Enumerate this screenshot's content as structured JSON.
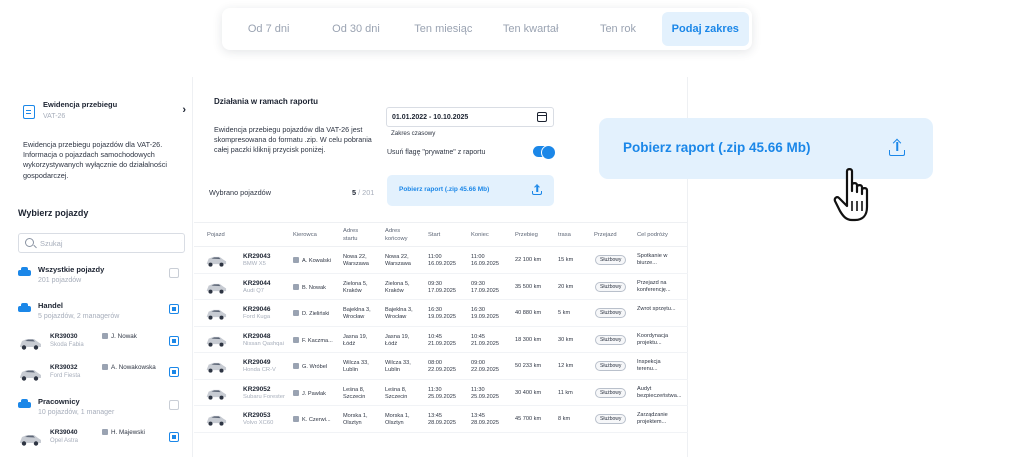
{
  "range_tabs": [
    {
      "label": "Od 7 dni",
      "active": false
    },
    {
      "label": "Od 30 dni",
      "active": false
    },
    {
      "label": "Ten miesiąc",
      "active": false
    },
    {
      "label": "Ten kwartał",
      "active": false
    },
    {
      "label": "Ten rok",
      "active": false
    },
    {
      "label": "Podaj zakres",
      "active": true
    }
  ],
  "left": {
    "report_title": "Ewidencja przebiegu",
    "report_sub": "VAT-26",
    "report_desc": "Ewidencja przebiegu pojazdów dla VAT-26. Informacja o pojazdach samochodowych wykorzystywanych wyłącznie do działalności gospodarczej.",
    "select_title": "Wybierz pojazdy",
    "search_placeholder": "Szukaj",
    "groups": [
      {
        "title": "Wszystkie pojazdy",
        "sub": "201 pojazdów",
        "checked": false
      },
      {
        "title": "Handel",
        "sub": "5 pojazdów, 2 managerów",
        "checked": true
      },
      {
        "title": "Pracownicy",
        "sub": "10 pojazdów, 1 manager",
        "checked": false
      }
    ],
    "vehicles": [
      {
        "plate": "KR39030",
        "model": "Skoda Fabia",
        "user": "J. Nowak",
        "checked": true
      },
      {
        "plate": "KR39032",
        "model": "Ford Fiesta",
        "user": "A. Nowakowska",
        "checked": true
      },
      {
        "plate": "KR39040",
        "model": "Opel Astra",
        "user": "H. Majewski",
        "checked": true
      }
    ]
  },
  "mid": {
    "title": "Działania w ramach raportu",
    "desc": "Ewidencja przebiegu pojazdów dla VAT-26 jest skompresowana do formatu .zip. W celu pobrania całej paczki kliknij przycisk poniżej.",
    "selected_label": "Wybrano pojazdów",
    "selected_count": "5",
    "selected_total": " / 201",
    "date_value": "01.01.2022 - 10.10.2025",
    "date_caption": "Zakres czasowy",
    "flag_label": "Usuń flagę \"prywatne\" z raportu",
    "download_small": "Pobierz raport (.zip 45.66 Mb)"
  },
  "table": {
    "headers": {
      "vehicle": "Pojazd",
      "driver": "Kierowca",
      "from_addr": "Adres startu",
      "to_addr": "Adres końcowy",
      "start": "Start",
      "end": "Koniec",
      "mileage": "Przebieg",
      "route": "trasa",
      "trip": "Przejazd",
      "purpose": "Cel podróży"
    },
    "rows": [
      {
        "plate": "KR29043",
        "model": "BMW X5",
        "driver": "A. Kowalski",
        "from": "Nowa 22, Warszawa",
        "to": "Nowa 22, Warszawa",
        "start": "11:00 16.09.2025",
        "end": "11:00 16.09.2025",
        "mileage": "22 100 km",
        "route": "15 km",
        "trip": "Służbowy",
        "purpose": "Spotkanie w biurze..."
      },
      {
        "plate": "KR29044",
        "model": "Audi Q7",
        "driver": "B. Nowak",
        "from": "Zielona 5, Kraków",
        "to": "Zielona 5, Kraków",
        "start": "09:30 17.09.2025",
        "end": "09:30 17.09.2025",
        "mileage": "35 500 km",
        "route": "20 km",
        "trip": "Służbowy",
        "purpose": "Przejazd na konferencję..."
      },
      {
        "plate": "KR29046",
        "model": "Ford Kuga",
        "driver": "D. Zieliński",
        "from": "Bajeklna 3, Wrocław",
        "to": "Bajeklna 3, Wrocław",
        "start": "16:30 19.09.2025",
        "end": "16:30 19.09.2025",
        "mileage": "40 880 km",
        "route": "5 km",
        "trip": "Służbowy",
        "purpose": "Zwrot sprzętu..."
      },
      {
        "plate": "KR29048",
        "model": "Nissan Qashqai",
        "driver": "F. Kaczma...",
        "from": "Jasna 19, Łódź",
        "to": "Jasna 19, Łódź",
        "start": "10:45 21.09.2025",
        "end": "10:45 21.09.2025",
        "mileage": "18 300 km",
        "route": "30 km",
        "trip": "Służbowy",
        "purpose": "Koordynacja projektu..."
      },
      {
        "plate": "KR29049",
        "model": "Honda CR-V",
        "driver": "G. Wróbel",
        "from": "Wilcza 33, Lublin",
        "to": "Wilcza 33, Lublin",
        "start": "08:00 22.09.2025",
        "end": "09:00 22.09.2025",
        "mileage": "50 233 km",
        "route": "12 km",
        "trip": "Służbowy",
        "purpose": "Inspekcja terenu..."
      },
      {
        "plate": "KR29052",
        "model": "Subaru Forester",
        "driver": "J. Pawlak",
        "from": "Leśna 8, Szczecin",
        "to": "Leśna 8, Szczecin",
        "start": "11:30 25.09.2025",
        "end": "11:30 25.09.2025",
        "mileage": "30 400 km",
        "route": "11 km",
        "trip": "Służbowy",
        "purpose": "Audyt bezpieczeństwa..."
      },
      {
        "plate": "KR29053",
        "model": "Volvo XC60",
        "driver": "K. Czerwi...",
        "from": "Morska 1, Olsztyn",
        "to": "Morska 1, Olsztyn",
        "start": "13:45 28.09.2025",
        "end": "13:45 28.09.2025",
        "mileage": "45 700 km",
        "route": "8 km",
        "trip": "Służbowy",
        "purpose": "Zarządzanie projektem..."
      }
    ]
  },
  "download_big": "Pobierz raport (.zip 45.66 Mb)",
  "colors": {
    "accent": "#1b87e8",
    "accent_bg": "#e3f1fd"
  }
}
